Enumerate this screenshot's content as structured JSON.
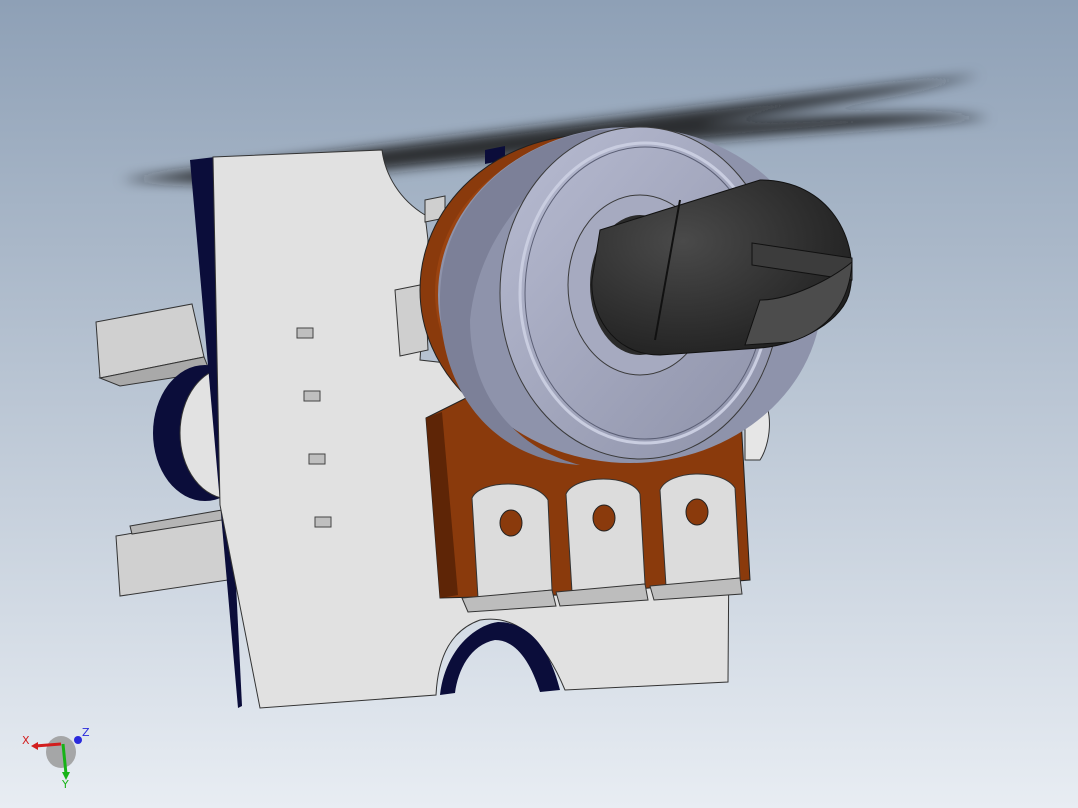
{
  "viewport": {
    "background_top": "#8ea0b6",
    "background_bottom": "#e8edf3"
  },
  "model": {
    "colors": {
      "plate": "#e0e0e0",
      "plate_edge": "#0b0d3a",
      "wafer": "#8a3a0c",
      "wafer_light": "#b05216",
      "bushing": "#9ea3bb",
      "bushing_rim": "#c6cadb",
      "shaft": "#2d2d2d",
      "shadow": "#1b1b1b",
      "terminal": "#d6d6d6"
    }
  },
  "triad": {
    "x_label": "X",
    "y_label": "Y",
    "z_label": "Z",
    "x_color": "#d21e1e",
    "y_color": "#17b317",
    "z_color": "#2a2adc"
  }
}
